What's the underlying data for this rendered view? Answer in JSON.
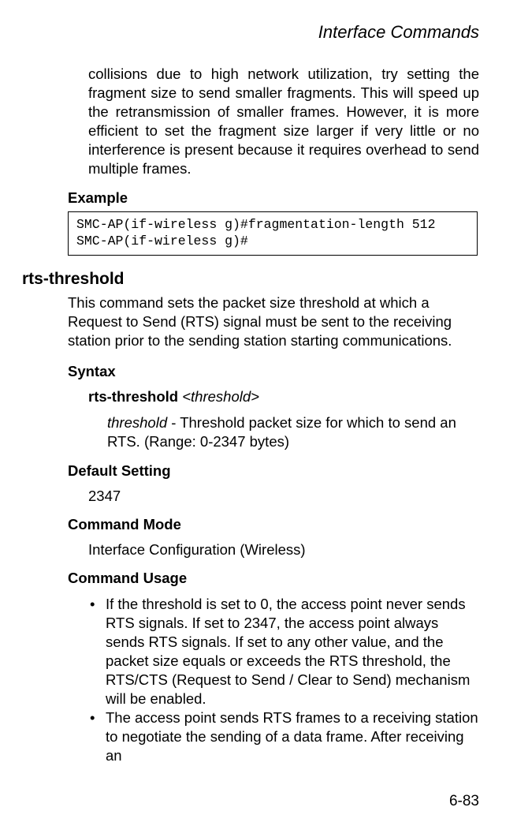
{
  "header": {
    "title": "Interface Commands"
  },
  "continued_paragraph": "collisions due to high network utilization, try setting the fragment size to send smaller fragments. This will speed up the retransmission of smaller frames. However, it is more efficient to set the fragment size larger if very little or no interference is present because it requires overhead to send multiple frames.",
  "labels": {
    "example": "Example",
    "syntax": "Syntax",
    "default_setting": "Default Setting",
    "command_mode": "Command Mode",
    "command_usage": "Command Usage"
  },
  "code_example": "SMC-AP(if-wireless g)#fragmentation-length 512\nSMC-AP(if-wireless g)#",
  "command": {
    "name": "rts-threshold",
    "description": "This command sets the packet size threshold at which a Request to Send (RTS) signal must be sent to the receiving station prior to the sending station starting communications.",
    "syntax_cmd": "rts-threshold",
    "syntax_arg_prefix": "<",
    "syntax_arg": "threshold",
    "syntax_arg_suffix": ">",
    "param_name": "threshold",
    "param_desc": " - Threshold packet size for which to send an RTS. (Range: 0-2347 bytes)",
    "default_value": "2347",
    "command_mode_value": "Interface Configuration (Wireless)",
    "usage_bullets": [
      "If the threshold is set to 0, the access point never sends RTS signals. If set to 2347, the access point always sends RTS signals. If set to any other value, and the packet size equals or exceeds the RTS threshold, the RTS/CTS (Request to Send / Clear to Send) mechanism will be enabled.",
      "The access point sends RTS frames to a receiving station to negotiate the sending of a data frame. After receiving an"
    ]
  },
  "page_number": "6-83"
}
